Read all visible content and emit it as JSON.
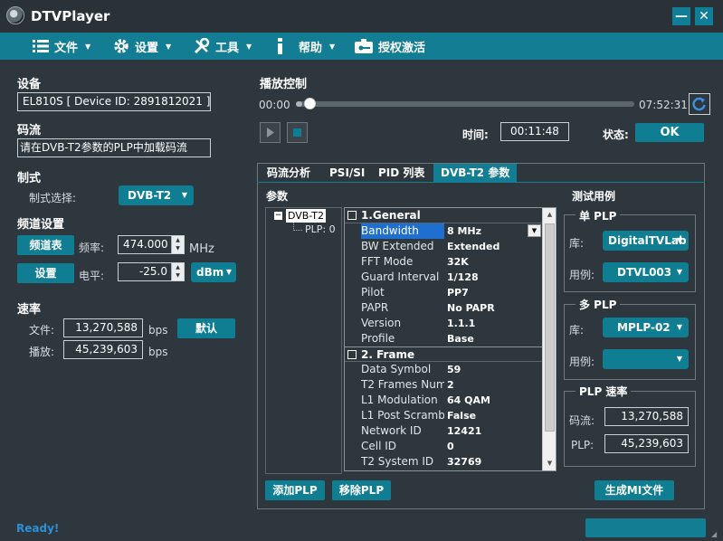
{
  "window": {
    "title": "DTVPlayer",
    "minimize_label": "—",
    "close_label": "✕"
  },
  "menu": {
    "file": "文件",
    "settings": "设置",
    "tools": "工具",
    "help": "帮助",
    "activate": "授权激活"
  },
  "device": {
    "section": "设备",
    "value": "EL810S [ Device ID: 2891812021 ]"
  },
  "stream": {
    "section": "码流",
    "value": "请在DVB-T2参数的PLP中加载码流"
  },
  "standard": {
    "section": "制式",
    "label": "制式选择:",
    "value": "DVB-T2"
  },
  "channel": {
    "section": "频道设置",
    "channel_table_button": "频道表",
    "freq_label": "频率:",
    "freq_value": "474.000",
    "freq_unit": "MHz",
    "set_button": "设置",
    "level_label": "电平:",
    "level_value": "-25.0",
    "level_unit": "dBm"
  },
  "rate": {
    "section": "速率",
    "file_label": "文件:",
    "file_value": "13,270,588",
    "file_unit": "bps",
    "default_button": "默认",
    "play_label": "播放:",
    "play_value": "45,239,603",
    "play_unit": "bps"
  },
  "playback": {
    "section": "播放控制",
    "start_time": "00:00",
    "end_time": "07:52:31",
    "progress": 0.02,
    "time_label": "时间:",
    "time_value": "00:11:48",
    "status_label": "状态:",
    "status_value": "OK"
  },
  "tabs": [
    "码流分析",
    "PSI/SI",
    "PID 列表",
    "DVB-T2 参数"
  ],
  "params": {
    "label": "参数",
    "tree_root": "DVB-T2",
    "tree_child": "PLP: 0",
    "general_header": "1.General",
    "frame_header": "2. Frame",
    "general": [
      {
        "k": "Bandwidth",
        "v": "8 MHz"
      },
      {
        "k": "BW Extended",
        "v": "Extended"
      },
      {
        "k": "FFT Mode",
        "v": "32K"
      },
      {
        "k": "Guard Interval",
        "v": "1/128"
      },
      {
        "k": "Pilot",
        "v": "PP7"
      },
      {
        "k": "PAPR",
        "v": "No PAPR"
      },
      {
        "k": "Version",
        "v": "1.1.1"
      },
      {
        "k": "Profile",
        "v": "Base"
      }
    ],
    "frame": [
      {
        "k": "Data Symbol",
        "v": "59"
      },
      {
        "k": "T2 Frames Num",
        "v": "2"
      },
      {
        "k": "L1 Modulation",
        "v": "64 QAM"
      },
      {
        "k": "L1 Post Scramb",
        "v": "False"
      },
      {
        "k": "Network ID",
        "v": "12421"
      },
      {
        "k": "Cell ID",
        "v": "0"
      },
      {
        "k": "T2 System ID",
        "v": "32769"
      }
    ],
    "add_plp_button": "添加PLP",
    "remove_plp_button": "移除PLP",
    "gen_mi_button": "生成MI文件"
  },
  "testcases": {
    "label": "测试用例",
    "single_plp": {
      "title": "单 PLP",
      "lib_label": "库:",
      "lib_value": "DigitalTVLab",
      "case_label": "用例:",
      "case_value": "DTVL003"
    },
    "multi_plp": {
      "title": "多 PLP",
      "lib_label": "库:",
      "lib_value": "MPLP-02",
      "case_label": "用例:",
      "case_value": ""
    },
    "plp_rate": {
      "title": "PLP 速率",
      "stream_label": "码流:",
      "stream_value": "13,270,588",
      "plp_label": "PLP:",
      "plp_value": "45,239,603"
    }
  },
  "status": {
    "text": "Ready!"
  },
  "colors": {
    "accent": "#127d93",
    "background": "#2e373d",
    "status_text": "#2f8fd6"
  }
}
